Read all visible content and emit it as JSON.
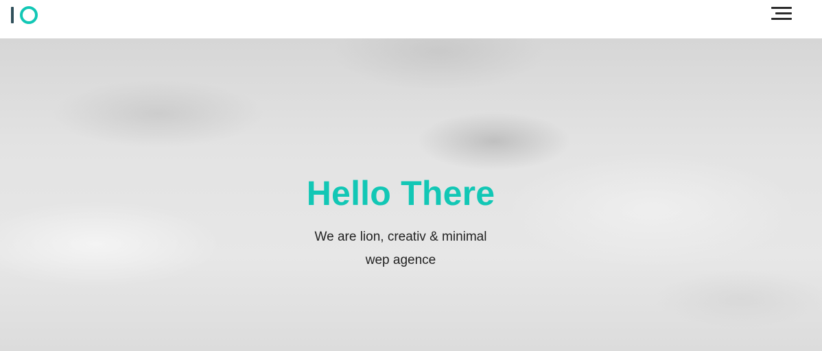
{
  "colors": {
    "accent": "#12c7b5",
    "logo_bar": "#2f4f5a",
    "menu_lines": "#2b2b2b",
    "header_bg": "#ffffff"
  },
  "header": {
    "logo_icon": "logo-io-icon",
    "menu_icon": "hamburger-menu-icon"
  },
  "hero": {
    "title": "Hello There",
    "subtitle_line1": "We are lion, creativ & minimal",
    "subtitle_line2": "wep agence"
  }
}
